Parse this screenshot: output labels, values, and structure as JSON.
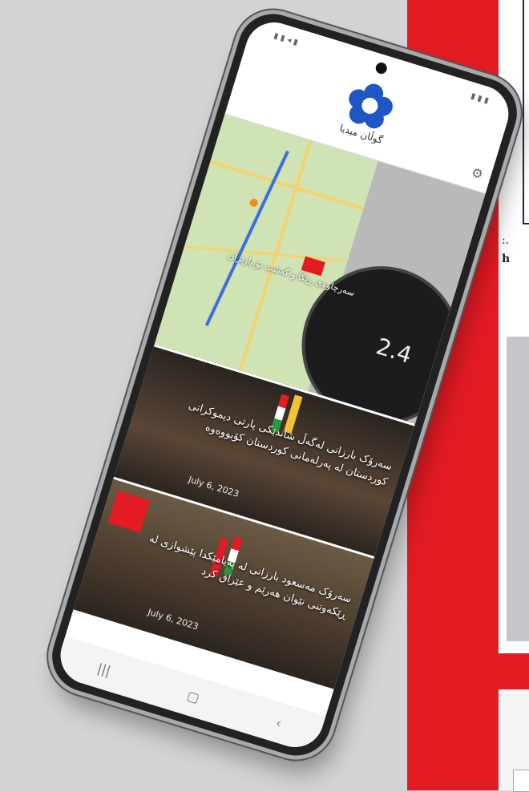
{
  "background": {
    "panel_text_1": ":.",
    "panel_text_2": "h",
    "colors": {
      "accent": "#e31b23",
      "background": "#d3d4d6"
    }
  },
  "phone": {
    "header": {
      "brand_name": "گوڵان میدیا",
      "logo_icon": "flower-logo-icon",
      "settings_icon": "gear-icon"
    },
    "hero": {
      "title": "سەرچاوەی ڕێگا و گەشت بۆ پارێزان",
      "watch_value": "2.4"
    },
    "articles": [
      {
        "title": "سەرۆک بارزانی لەگەڵ شاندێکی پارتی دیموکراتی کوردستان لە پەرلەمانی کوردستان کۆبووەوە",
        "date": "July 6, 2023"
      },
      {
        "title": "سەرۆک مەسعود بارزانی لە پەیامێکدا پێشوازی لە ڕێکەوتنی نێوان هەرێم و عێراق کرد",
        "date": "July 6, 2023"
      }
    ],
    "navbar": {
      "icons": [
        "menu-icon",
        "home-icon",
        "back-icon"
      ],
      "glyphs": [
        "|||",
        "▢",
        "‹"
      ]
    }
  }
}
